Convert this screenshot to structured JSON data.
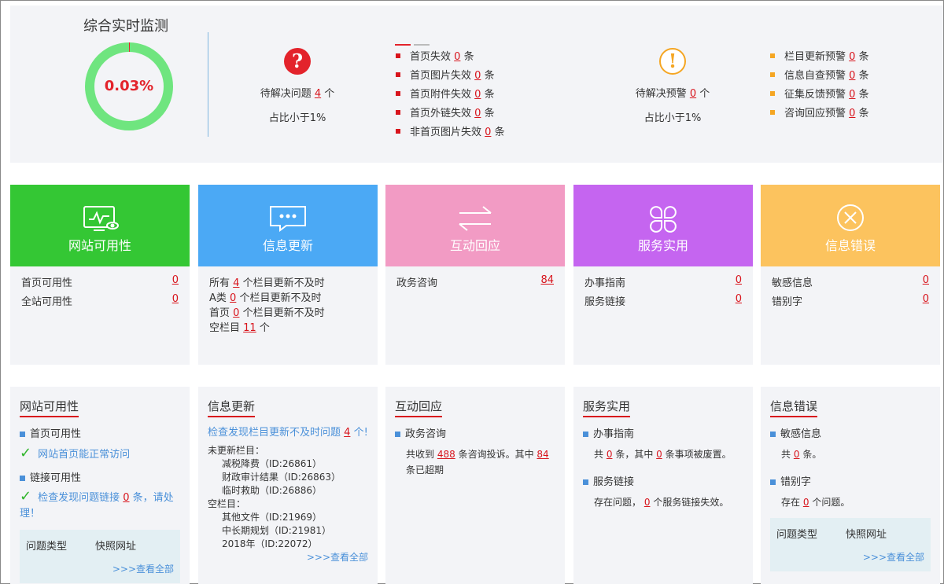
{
  "summary": {
    "title": "综合实时监测",
    "rate": "0.03%",
    "issues": {
      "prefix": "待解决问题",
      "count": "4",
      "suffix": "个",
      "ratio": "占比小于1%"
    },
    "warnings": {
      "prefix": "待解决预警",
      "count": "0",
      "suffix": "个",
      "ratio": "占比小于1%"
    },
    "issue_items": [
      {
        "label": "首页失效",
        "count": "0",
        "unit": "条"
      },
      {
        "label": "首页图片失效",
        "count": "0",
        "unit": "条"
      },
      {
        "label": "首页附件失效",
        "count": "0",
        "unit": "条"
      },
      {
        "label": "首页外链失效",
        "count": "0",
        "unit": "条"
      },
      {
        "label": "非首页图片失效",
        "count": "0",
        "unit": "条"
      }
    ],
    "warning_items": [
      {
        "label": "栏目更新预警",
        "count": "0",
        "unit": "条"
      },
      {
        "label": "信息自查预警",
        "count": "0",
        "unit": "条"
      },
      {
        "label": "征集反馈预警",
        "count": "0",
        "unit": "条"
      },
      {
        "label": "咨询回应预警",
        "count": "0",
        "unit": "条"
      }
    ],
    "colors": {
      "ring": "#6fe57f",
      "issue": "#e3232b",
      "warning": "#f5a623"
    }
  },
  "tiles": [
    {
      "label": "网站可用性",
      "icon": "monitor-eye-icon",
      "color": "#34c734",
      "rows": [
        {
          "label": "首页可用性",
          "value": "0"
        },
        {
          "label": "全站可用性",
          "value": "0"
        }
      ]
    },
    {
      "label": "信息更新",
      "icon": "chat-bubble-icon",
      "color": "#4ba9f5",
      "lines": [
        {
          "a": "所有",
          "n": "4",
          "b": "个栏目更新不及时"
        },
        {
          "a": "A类",
          "n": "0",
          "b": "个栏目更新不及时"
        },
        {
          "a": "首页",
          "n": "0",
          "b": "个栏目更新不及时"
        },
        {
          "a": "空栏目",
          "n": "11",
          "b": "个"
        }
      ]
    },
    {
      "label": "互动回应",
      "icon": "swap-arrows-icon",
      "color": "#f29bc4",
      "rows": [
        {
          "label": "政务咨询",
          "value": "84"
        }
      ]
    },
    {
      "label": "服务实用",
      "icon": "clover-icon",
      "color": "#c565f0",
      "rows": [
        {
          "label": "办事指南",
          "value": "0"
        },
        {
          "label": "服务链接",
          "value": "0"
        }
      ]
    },
    {
      "label": "信息错误",
      "icon": "circle-x-icon",
      "color": "#fcc35e",
      "rows": [
        {
          "label": "敏感信息",
          "value": "0"
        },
        {
          "label": "错别字",
          "value": "0"
        }
      ]
    }
  ],
  "panels": {
    "availability": {
      "title": "网站可用性",
      "sec1": "首页可用性",
      "msg1": "网站首页能正常访问",
      "sec2": "链接可用性",
      "msg2a": "检查发现问题链接",
      "msg2n": "0",
      "msg2b": "条，请处理！",
      "col1": "问题类型",
      "col2": "快照网址",
      "more": ">>>查看全部"
    },
    "update": {
      "title": "信息更新",
      "intro_a": "检查发现栏目更新不及时问题",
      "intro_n": "4",
      "intro_b": "个!",
      "unupdated_label": "未更新栏目：",
      "unupdated": [
        "减税降费（ID:26861）",
        "财政审计结果（ID:26863）",
        "临时救助（ID:26886）"
      ],
      "empty_label": "空栏目：",
      "empty": [
        "其他文件（ID:21969）",
        "中长期规划（ID:21981）",
        "2018年（ID:22072）"
      ],
      "more": ">>>查看全部"
    },
    "interaction": {
      "title": "互动回应",
      "sec": "政务咨询",
      "a": "共收到",
      "n1": "488",
      "b": "条咨询投诉。其中",
      "n2": "84",
      "c": "条已超期"
    },
    "service": {
      "title": "服务实用",
      "sec1": "办事指南",
      "s1a": "共",
      "s1n": "0",
      "s1b": "条，其中",
      "s1n2": "0",
      "s1c": "条事项被废置。",
      "sec2": "服务链接",
      "s2a": "存在问题，",
      "s2n": "0",
      "s2b": "个服务链接失效。"
    },
    "errors": {
      "title": "信息错误",
      "sec1": "敏感信息",
      "e1a": "共",
      "e1n": "0",
      "e1b": "条。",
      "sec2": "错别字",
      "e2a": "存在",
      "e2n": "0",
      "e2b": "个问题。",
      "col1": "问题类型",
      "col2": "快照网址",
      "more": ">>>查看全部"
    }
  }
}
